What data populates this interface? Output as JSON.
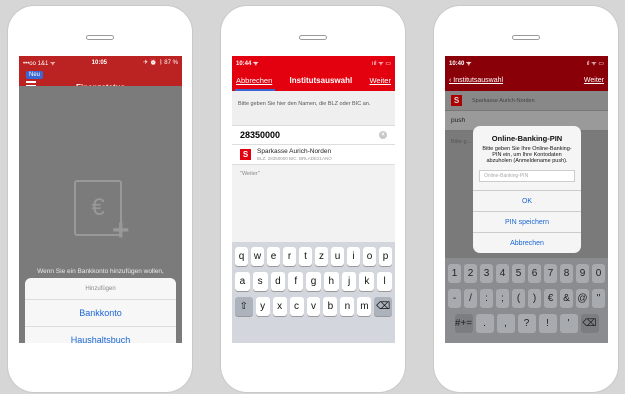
{
  "phone1": {
    "status": {
      "carrier": "•••oo 1&1 ᯤ",
      "time": "10:05",
      "battery": "✈ ⏰ ᛒ 87 %"
    },
    "badge": "Neu",
    "title": "Finanzstatus",
    "empty_hint": "Wenn Sie ein Bankkonto hinzufügen wollen,",
    "sheet": {
      "header": "Hinzufügen",
      "items": [
        "Bankkonto",
        "Haushaltsbuch"
      ]
    }
  },
  "phone2": {
    "status": {
      "time": "10:44 ᯤ",
      "right": "ııl ᯤ ▭"
    },
    "nav": {
      "cancel": "Abbrechen",
      "title": "Institutsauswahl",
      "next": "Weiter"
    },
    "prompt": "Bitte geben Sie hier den Namen, die BLZ oder BIC an.",
    "search_value": "28350000",
    "clear": "×",
    "result": {
      "logo": "S",
      "name": "Sparkasse Aurich-Norden",
      "meta": "BLZ: 28350000   BIC: BRLADE21ANO"
    },
    "weiter_hint": "\"Weiter\"",
    "keyboard": {
      "row1": [
        "q",
        "w",
        "e",
        "r",
        "t",
        "z",
        "u",
        "i",
        "o",
        "p"
      ],
      "row2": [
        "a",
        "s",
        "d",
        "f",
        "g",
        "h",
        "j",
        "k",
        "l"
      ],
      "row3": [
        "y",
        "x",
        "c",
        "v",
        "b",
        "n",
        "m"
      ],
      "shift": "⇧",
      "backspace": "⌫"
    }
  },
  "phone3": {
    "status": {
      "time": "10:40 ᯤ",
      "right": "ıl ᯤ ▭"
    },
    "nav": {
      "back": "‹ Institutsauswahl",
      "next": "Weiter"
    },
    "bg_row1": "Sparkasse Aurich-Norden",
    "bg_row2": "push",
    "bg_hint": "Bitte g... Konten... \"Weite...",
    "alert": {
      "title": "Online-Banking-PIN",
      "message": "Bitte geben Sie Ihre Online-Banking-PIN ein, um Ihre Kontodaten abzuholen (Anmeldename push).",
      "placeholder": "Online-Banking-PIN",
      "buttons": [
        "OK",
        "PIN speichern",
        "Abbrechen"
      ]
    },
    "keyboard": {
      "row1": [
        "1",
        "2",
        "3",
        "4",
        "5",
        "6",
        "7",
        "8",
        "9",
        "0"
      ],
      "row2": [
        "-",
        "/",
        ":",
        ";",
        "(",
        ")",
        "€",
        "&",
        "@",
        "\""
      ],
      "row3": [
        "#+=",
        ".",
        ",",
        "?",
        "!",
        "'",
        "⌫"
      ]
    }
  }
}
